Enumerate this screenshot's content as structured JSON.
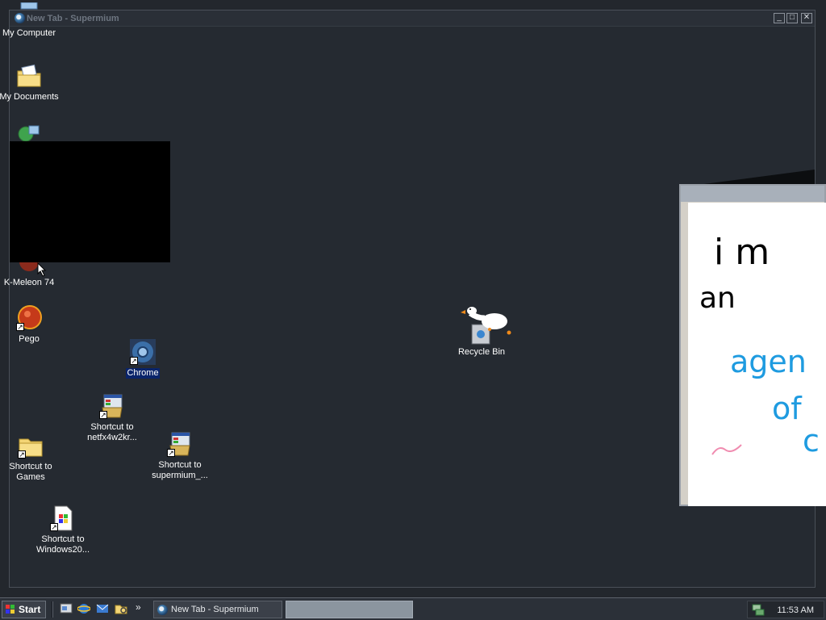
{
  "window": {
    "title": "New Tab - Supermium",
    "minimize_label": "_",
    "maximize_label": "□",
    "close_label": "✕"
  },
  "desktop": {
    "icons": [
      {
        "label": "My Computer",
        "icon": "my-computer-icon"
      },
      {
        "label": "My Documents",
        "icon": "folder-documents-icon"
      },
      {
        "label": "K-Meleon 74",
        "icon": "kmeleon-icon"
      },
      {
        "label": "Pego",
        "icon": "pego-icon"
      },
      {
        "label": "Chrome",
        "icon": "chrome-icon"
      },
      {
        "label": "Shortcut to netfx4w2kr...",
        "icon": "installer-icon"
      },
      {
        "label": "Shortcut to Games",
        "icon": "folder-icon"
      },
      {
        "label": "Shortcut to supermium_...",
        "icon": "installer-icon"
      },
      {
        "label": "Shortcut to Windows20...",
        "icon": "document-icon"
      },
      {
        "label": "Recycle Bin",
        "icon": "recycle-bin-icon"
      }
    ]
  },
  "paint": {
    "handwriting": [
      "i m",
      "an",
      "agen",
      "of",
      "c"
    ]
  },
  "taskbar": {
    "start_label": "Start",
    "task_item_label": "New Tab - Supermium",
    "clock": "11:53 AM",
    "chevron": "»"
  },
  "colors": {
    "desktop_bg": "#23272d",
    "selection": "#0a246a",
    "ink_black": "#000000",
    "ink_blue": "#1e9be0",
    "ink_pink": "#f08cb0"
  }
}
